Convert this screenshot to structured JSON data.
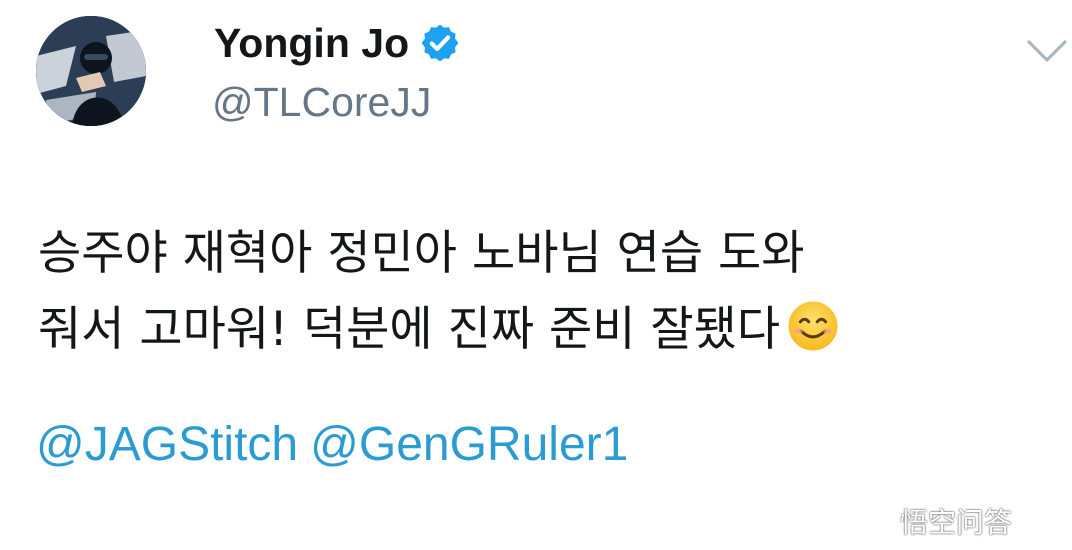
{
  "tweet": {
    "display_name": "Yongin Jo",
    "handle": "@TLCoreJJ",
    "verified": true,
    "text_lines": [
      "승주야 재혁아 정민아 노바님 연습 도와",
      "줘서 고마워! 덕분에 진짜 준비 잘됐다"
    ],
    "mentions": [
      "@JAGStitch",
      "@GenGRuler1"
    ]
  },
  "watermark": {
    "text": "悟空问答"
  },
  "icons": {
    "verified": "verified-badge-icon",
    "menu": "chevron-down-icon",
    "emoji": "smiling-face-emoji-icon",
    "watermark_logo": "wukong-logo-icon"
  },
  "colors": {
    "name": "#14171a",
    "handle": "#657786",
    "mention": "#2b9bd3",
    "verified": "#1da1f2",
    "chevron": "#aab8c2"
  }
}
